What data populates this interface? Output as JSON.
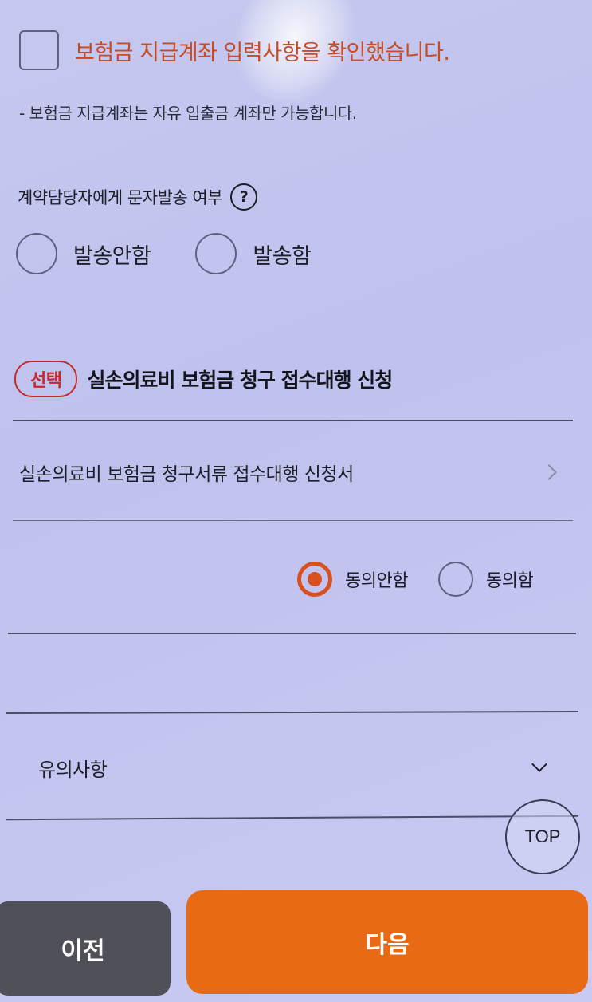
{
  "confirm": {
    "checked": false,
    "label": "보험금 지급계좌 입력사항을 확인했습니다.",
    "note": "-  보험금 지급계좌는 자유 입출금 계좌만 가능합니다."
  },
  "sms": {
    "label": "계약담당자에게 문자발송 여부",
    "help_icon": "?",
    "options": [
      {
        "label": "발송안함",
        "selected": false
      },
      {
        "label": "발송함",
        "selected": false
      }
    ]
  },
  "section": {
    "badge": "선택",
    "title": "실손의료비 보험금 청구 접수대행 신청",
    "document_link": "실손의료비 보험금 청구서류 접수대행 신청서",
    "consent_options": [
      {
        "label": "동의안함",
        "selected": true
      },
      {
        "label": "동의함",
        "selected": false
      }
    ]
  },
  "notice": {
    "label": "유의사항",
    "expanded": false
  },
  "top_button": "TOP",
  "footer": {
    "prev_label": "이전",
    "next_label": "다음"
  },
  "colors": {
    "accent": "#e86a14",
    "radio_selected": "#d8501d",
    "badge": "#c8282a",
    "confirm_text": "#c94a23",
    "prev_button": "#505058"
  }
}
